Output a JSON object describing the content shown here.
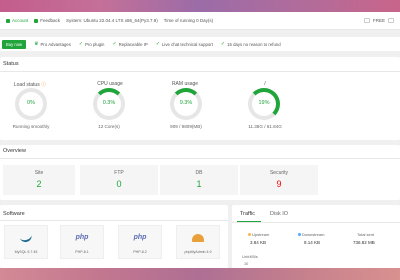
{
  "topbar": {
    "account": "Account",
    "feedback": "Feedback",
    "system": "System: Ubuntu 22.04.4 LTS x86_64(Py3.7.9)",
    "uptime": "Time of running 0 Day(s)",
    "right": "FREE"
  },
  "pro": {
    "buy": "Buy now",
    "all": "Pro Advantages",
    "features": [
      "Pro plugin",
      "Replaceable IP",
      "Live chat technical support",
      "15 days no reason to refund"
    ]
  },
  "status": {
    "title": "Status",
    "gauges": [
      {
        "label": "Load status",
        "value": "0%",
        "sub": "Running smoothly",
        "fraction": 0
      },
      {
        "label": "CPU usage",
        "value": "0.3%",
        "sub": "12 Core(s)",
        "fraction": 0.003
      },
      {
        "label": "RAM usage",
        "value": "9.3%",
        "sub": "909 / 9809(MB)",
        "fraction": 0.093
      },
      {
        "label": "/",
        "value": "19%",
        "sub": "11.38G / 61.84G",
        "fraction": 0.19
      }
    ]
  },
  "overview": {
    "title": "Overview",
    "items": [
      {
        "label": "Site",
        "value": "2",
        "color": "#20a53a"
      },
      {
        "label": "FTP",
        "value": "0",
        "color": "#20a53a"
      },
      {
        "label": "DB",
        "value": "1",
        "color": "#20a53a"
      },
      {
        "label": "Security",
        "value": "9",
        "color": "#ef0808"
      }
    ]
  },
  "software": {
    "title": "Software",
    "items": [
      {
        "logo": "",
        "name": "MySQL 5.7.45"
      },
      {
        "logo": "php",
        "name": "PHP-8.1"
      },
      {
        "logo": "php",
        "name": "PHP-8.2"
      },
      {
        "logo": "",
        "name": "phpMyAdmin 4.9"
      }
    ]
  },
  "traffic": {
    "tabs": [
      "Traffic",
      "Disk IO"
    ],
    "upstream_label": "Upstream",
    "upstream": "3.84 KB",
    "downstream_label": "Downstream",
    "downstream": "8.14 KB",
    "total_sent_label": "Total sent",
    "total_sent": "736.82 MB",
    "unit_label": "Unit:KB/s",
    "y_tick": "10",
    "colors": {
      "up": "#f7b851",
      "down": "#52a9ff"
    }
  }
}
